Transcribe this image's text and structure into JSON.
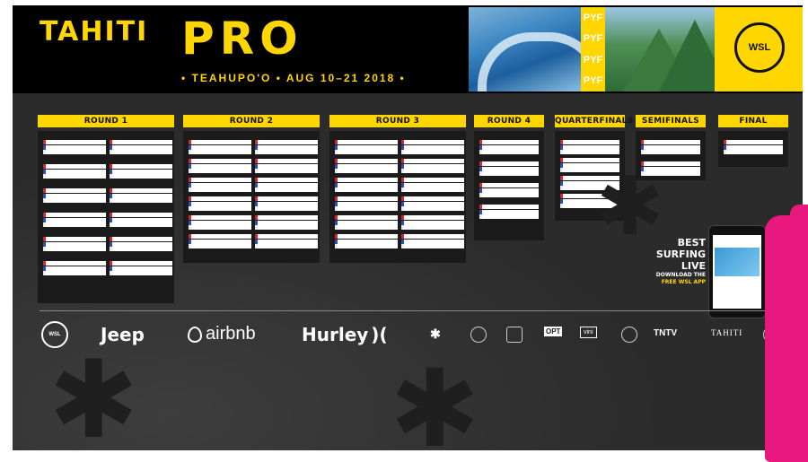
{
  "header": {
    "title_left": "TAHITI",
    "title_right": "PRO",
    "subtitle": "• TEAHUPO'O • AUG 10–21 2018 •",
    "pyf": [
      "PYF",
      "PYF",
      "PYF",
      "PYF"
    ],
    "logo": "WSL"
  },
  "rounds": [
    {
      "name": "ROUND 1",
      "heats": 12
    },
    {
      "name": "ROUND 2",
      "heats": 12
    },
    {
      "name": "ROUND 3",
      "heats": 12
    },
    {
      "name": "ROUND 4",
      "heats": 4
    },
    {
      "name": "QUARTERFINALS",
      "heats": 4
    },
    {
      "name": "SEMIFINALS",
      "heats": 2
    },
    {
      "name": "FINAL",
      "heats": 1
    }
  ],
  "promo": {
    "line1": "BEST",
    "line2": "SURFING",
    "line3": "LIVE",
    "line4": "DOWNLOAD THE",
    "line5": "FREE WSL APP"
  },
  "sponsors": {
    "wsl": "WSL",
    "jeep": "Jeep",
    "airbnb": "airbnb",
    "hurley": "Hurley",
    "opt": "OPT",
    "vini": "vini",
    "tntv": "TNTV",
    "tahiti": "TAHITI"
  },
  "colors": {
    "accent": "#ffd600",
    "background": "#2b2b2b",
    "red": "#d6262f",
    "blue": "#2c4fb5",
    "pink": "#e8187e"
  }
}
